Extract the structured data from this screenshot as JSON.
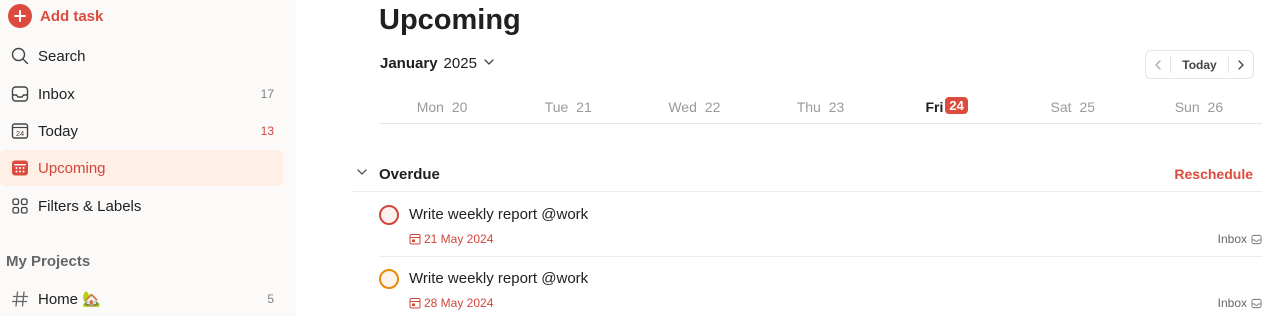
{
  "sidebar": {
    "add_task": "Add task",
    "items": [
      {
        "label": "Search",
        "icon": "search-icon",
        "count": ""
      },
      {
        "label": "Inbox",
        "icon": "inbox-icon",
        "count": "17"
      },
      {
        "label": "Today",
        "icon": "calendar-today-icon",
        "count": "13",
        "today_number": "24"
      },
      {
        "label": "Upcoming",
        "icon": "calendar-upcoming-icon",
        "count": ""
      },
      {
        "label": "Filters & Labels",
        "icon": "filters-icon",
        "count": ""
      }
    ],
    "projects_title": "My Projects",
    "projects": [
      {
        "label": "Home 🏡",
        "icon": "hash-icon",
        "count": "5"
      }
    ]
  },
  "main": {
    "title": "Upcoming",
    "month": "January",
    "year": "2025",
    "today_button": "Today",
    "days": [
      {
        "name": "Mon",
        "num": "20"
      },
      {
        "name": "Tue",
        "num": "21"
      },
      {
        "name": "Wed",
        "num": "22"
      },
      {
        "name": "Thu",
        "num": "23"
      },
      {
        "name": "Fri",
        "num": "24"
      },
      {
        "name": "Sat",
        "num": "25"
      },
      {
        "name": "Sun",
        "num": "26"
      }
    ],
    "overdue": {
      "title": "Overdue",
      "reschedule": "Reschedule",
      "tasks": [
        {
          "title": "Write weekly report @work",
          "date": "21 May 2024",
          "project": "Inbox",
          "priority_color": "#d1453b"
        },
        {
          "title": "Write weekly report @work",
          "date": "28 May 2024",
          "project": "Inbox",
          "priority_color": "#eb8909"
        }
      ]
    }
  },
  "colors": {
    "accent": "#dc4c3e",
    "sidebar_bg": "#fcfaf8",
    "active_bg": "#ffefe5"
  }
}
